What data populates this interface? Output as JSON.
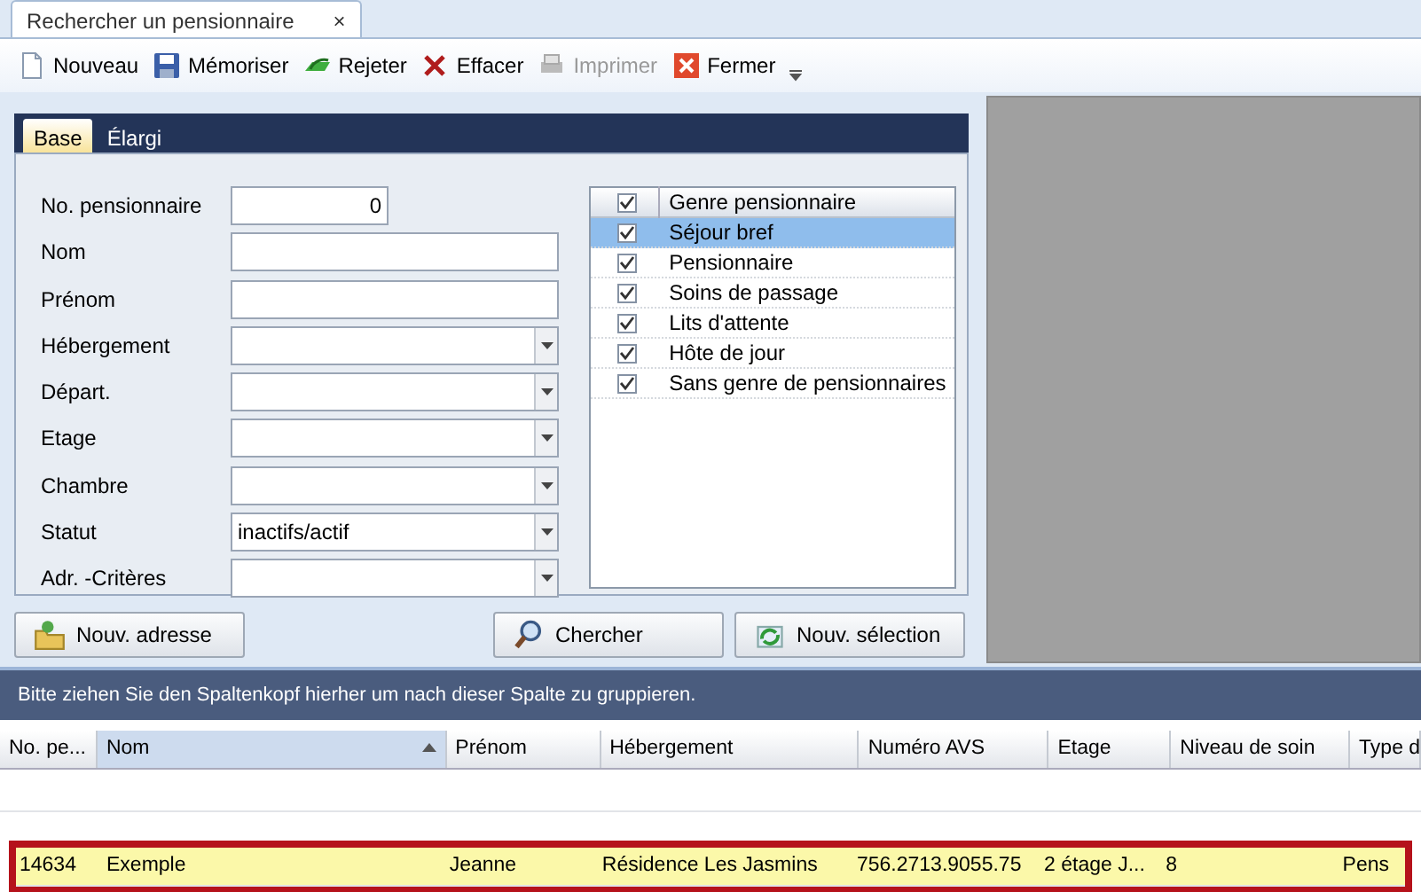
{
  "document_tab": {
    "title": "Rechercher un pensionnaire",
    "close": "×"
  },
  "toolbar": [
    {
      "label": "Nouveau",
      "kind": "new",
      "disabled": false
    },
    {
      "label": "Mémoriser",
      "kind": "save",
      "disabled": false
    },
    {
      "label": "Rejeter",
      "kind": "discard",
      "disabled": false
    },
    {
      "label": "Effacer",
      "kind": "delete",
      "disabled": false
    },
    {
      "label": "Imprimer",
      "kind": "print",
      "disabled": true
    },
    {
      "label": "Fermer",
      "kind": "close",
      "disabled": false
    }
  ],
  "search_tabs": [
    {
      "label": "Base",
      "selected": true
    },
    {
      "label": "Élargi",
      "selected": false
    }
  ],
  "fields": [
    {
      "label": "No. pensionnaire",
      "kind": "number",
      "value": "0"
    },
    {
      "label": "Nom",
      "kind": "text"
    },
    {
      "label": "Prénom",
      "kind": "text"
    },
    {
      "label": "Hébergement",
      "kind": "combo"
    },
    {
      "label": "Départ.",
      "kind": "combo"
    },
    {
      "label": "Etage",
      "kind": "combo"
    },
    {
      "label": "Chambre",
      "kind": "combo"
    },
    {
      "label": "Statut",
      "kind": "combo",
      "value": "inactifs/actif"
    },
    {
      "label": "Adr. -Critères",
      "kind": "combo"
    }
  ],
  "resident_types": {
    "header": {
      "label": "Genre pensionnaire",
      "checked": true
    },
    "items": [
      {
        "label": "Séjour bref",
        "checked": true,
        "selected": true
      },
      {
        "label": "Pensionnaire",
        "checked": true,
        "selected": false
      },
      {
        "label": "Soins de passage",
        "checked": true,
        "selected": false
      },
      {
        "label": "Lits d'attente",
        "checked": true,
        "selected": false
      },
      {
        "label": "Hôte de jour",
        "checked": true,
        "selected": false
      },
      {
        "label": "Sans genre de pensionnaires",
        "checked": true,
        "selected": false
      }
    ]
  },
  "buttons": [
    {
      "label": "Nouv. adresse",
      "kind": "address"
    },
    {
      "label": "Chercher",
      "kind": "search"
    },
    {
      "label": "Nouv. sélection",
      "kind": "refresh"
    }
  ],
  "grid": {
    "group_hint": "Bitte ziehen Sie den Spaltenkopf hierher um nach dieser Spalte zu gruppieren.",
    "columns": [
      {
        "label": "No. pe...",
        "sorted": false
      },
      {
        "label": "Nom",
        "sorted": true
      },
      {
        "label": "Prénom",
        "sorted": false
      },
      {
        "label": "Hébergement",
        "sorted": false
      },
      {
        "label": "Numéro AVS",
        "sorted": false
      },
      {
        "label": "Etage",
        "sorted": false
      },
      {
        "label": "Niveau de soin",
        "sorted": false
      },
      {
        "label": "Type d",
        "sorted": false
      }
    ],
    "rows": [
      {
        "cells": [
          "14634",
          "Exemple",
          "Jeanne",
          "Résidence Les Jasmins",
          "756.2713.9055.75",
          "2 étage J...",
          "8",
          "Pens"
        ],
        "selected": true,
        "highlighted": true
      }
    ]
  }
}
